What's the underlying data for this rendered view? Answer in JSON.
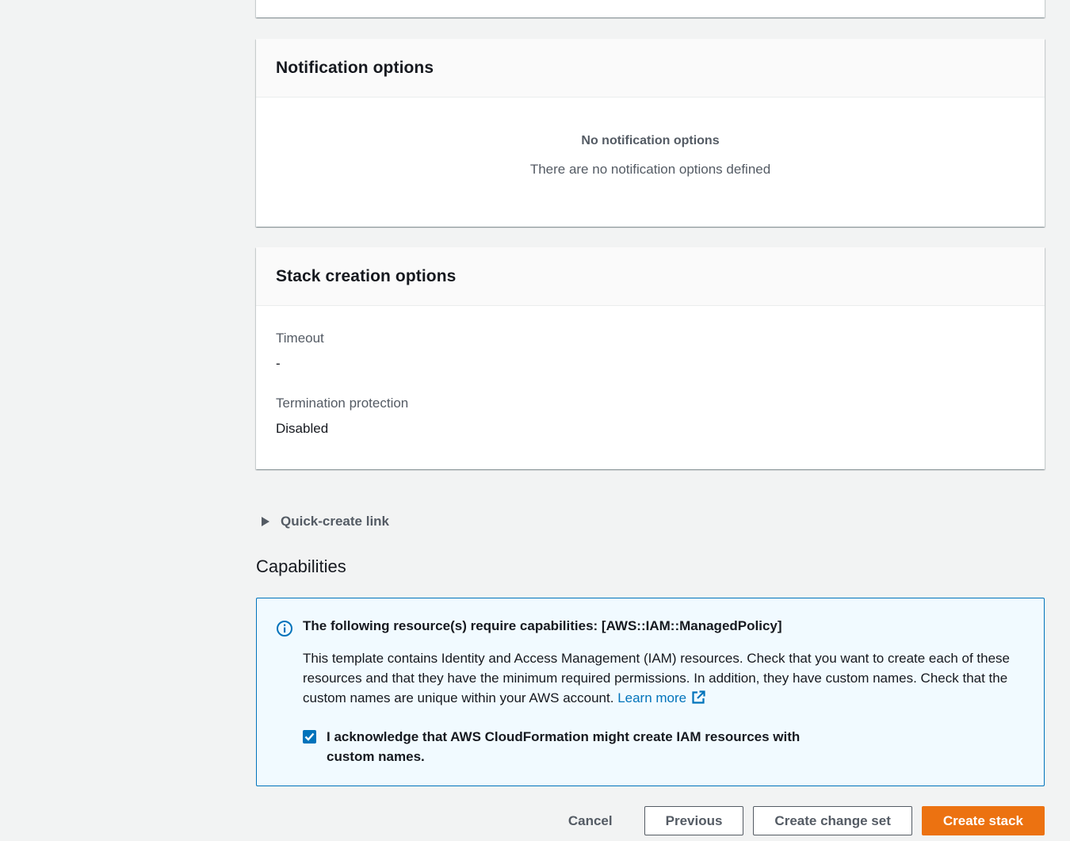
{
  "notification_panel": {
    "title": "Notification options",
    "empty_title": "No notification options",
    "empty_description": "There are no notification options defined"
  },
  "stack_creation_panel": {
    "title": "Stack creation options",
    "timeout_label": "Timeout",
    "timeout_value": "-",
    "termination_label": "Termination protection",
    "termination_value": "Disabled"
  },
  "quick_create": {
    "label": "Quick-create link"
  },
  "capabilities": {
    "heading": "Capabilities",
    "alert_title": "The following resource(s) require capabilities: [AWS::IAM::ManagedPolicy]",
    "alert_body": "This template contains Identity and Access Management (IAM) resources. Check that you want to create each of these resources and that they have the minimum required permissions. In addition, they have custom names. Check that the custom names are unique within your AWS account.",
    "learn_more": "Learn more",
    "acknowledge_label": "I acknowledge that AWS CloudFormation might create IAM resources with custom names.",
    "acknowledge_checked": true
  },
  "actions": {
    "cancel": "Cancel",
    "previous": "Previous",
    "create_change_set": "Create change set",
    "create_stack": "Create stack"
  },
  "colors": {
    "primary_button": "#ec7211",
    "link": "#0073bb",
    "info_background": "#f1faff",
    "page_background": "#f2f3f3"
  }
}
